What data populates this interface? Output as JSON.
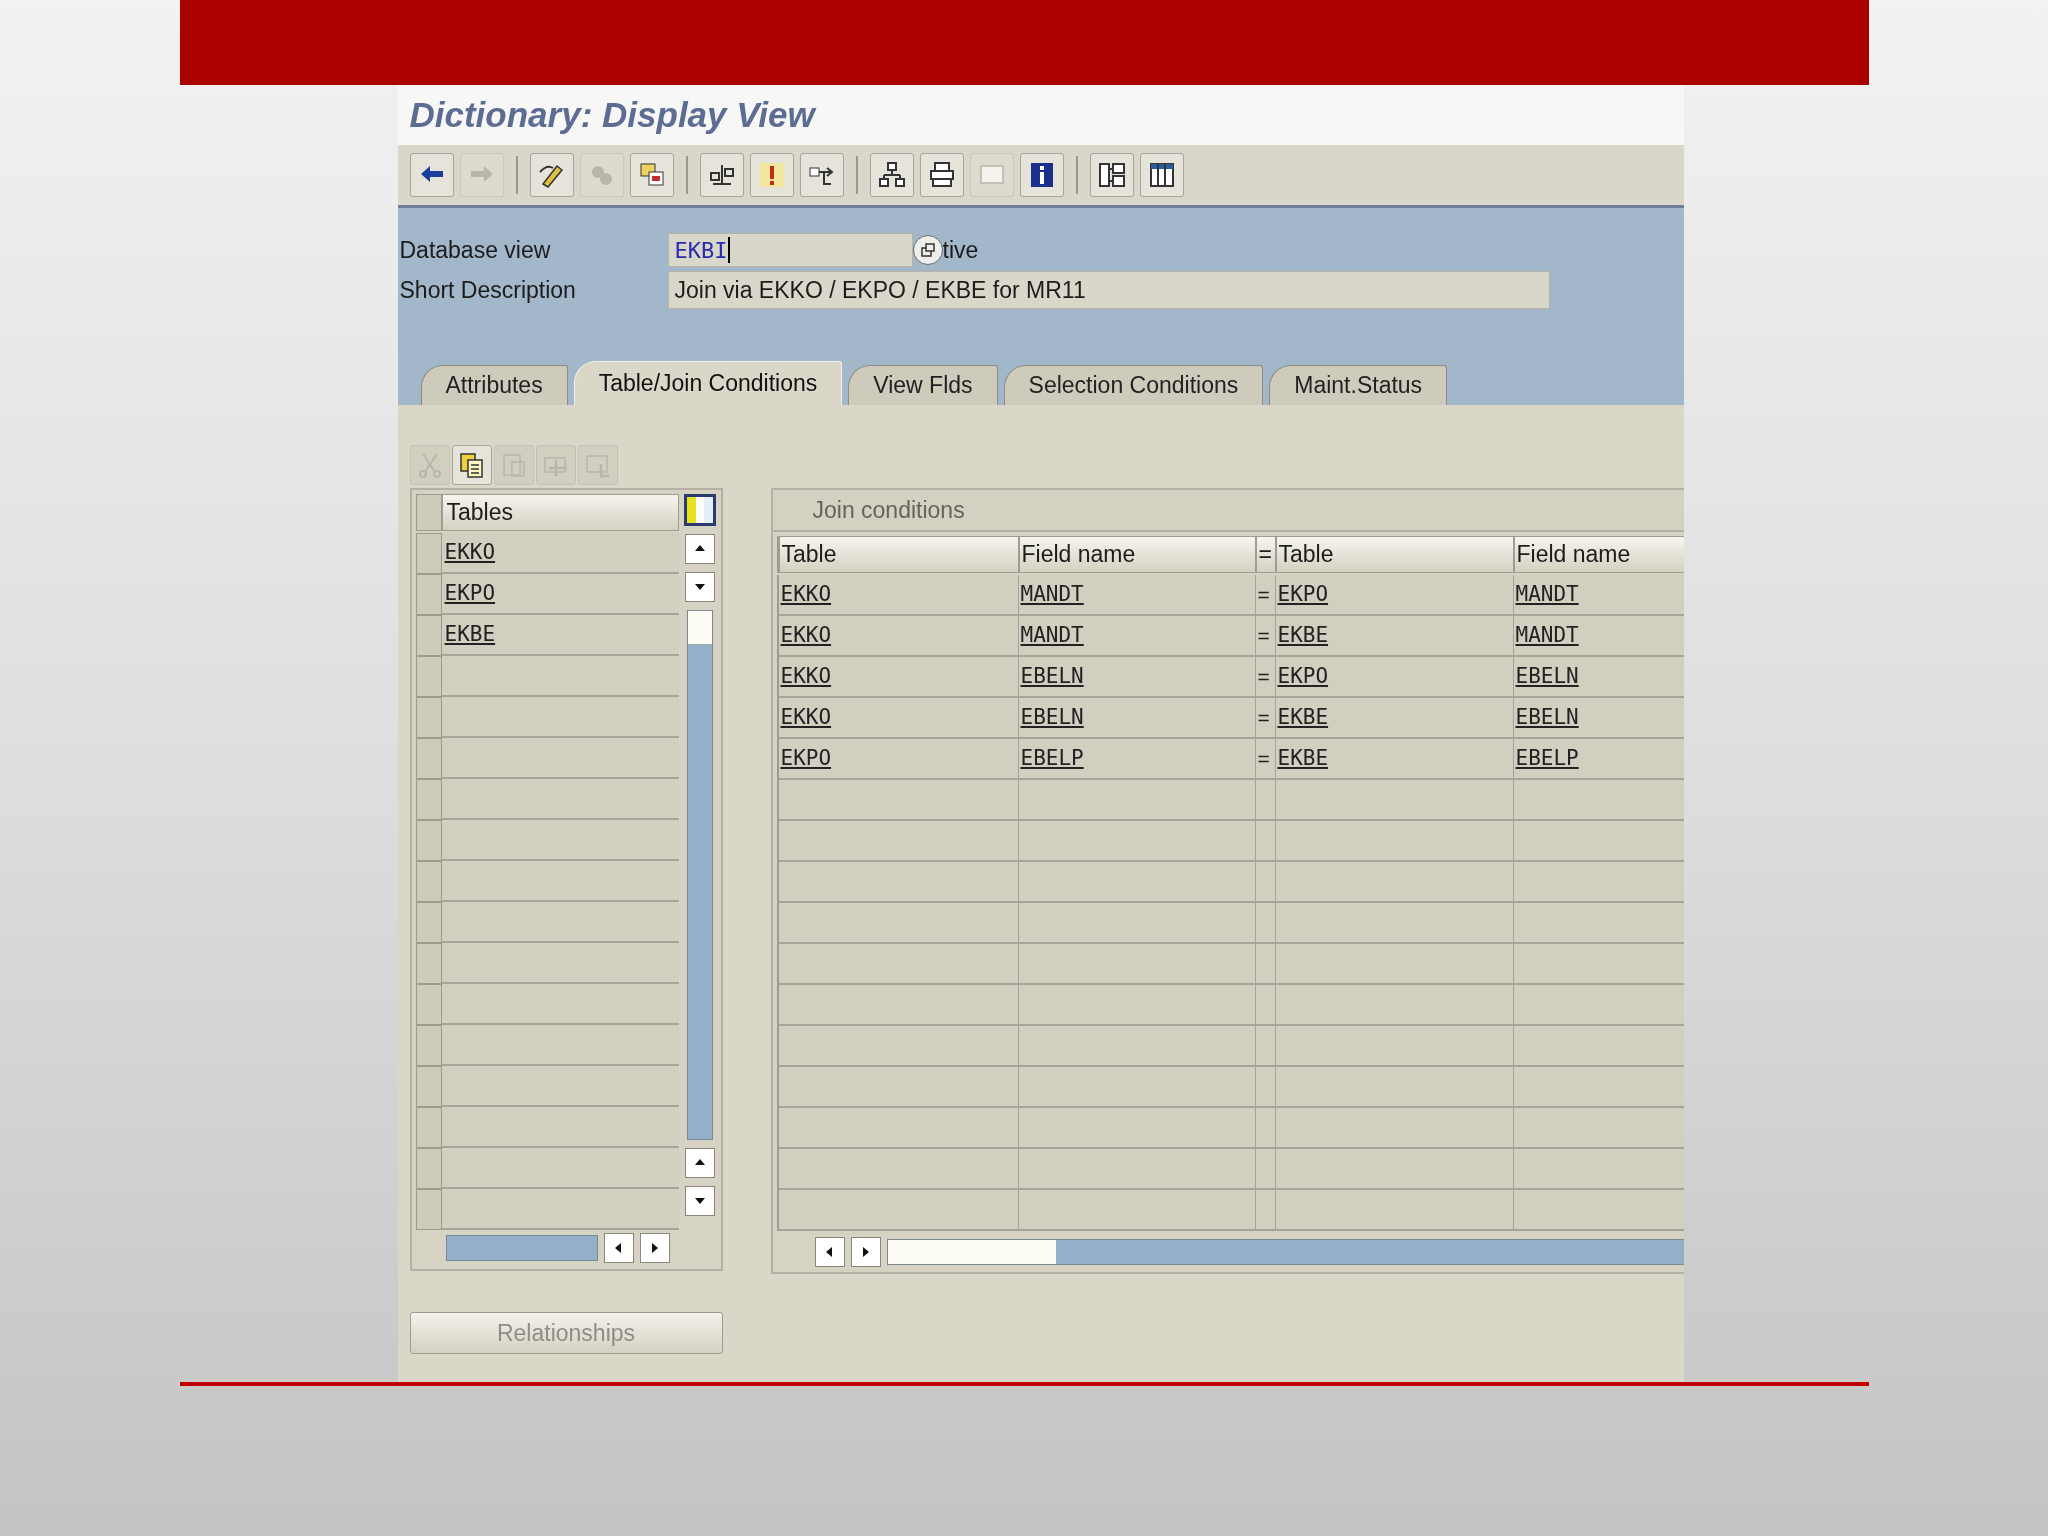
{
  "window": {
    "title": "Dictionary: Display View"
  },
  "toolbar_groups": [
    {
      "buttons": [
        {
          "kind": "back",
          "disabled": false
        },
        {
          "kind": "forward",
          "disabled": true
        }
      ]
    },
    {
      "buttons": [
        {
          "kind": "edit",
          "disabled": false
        },
        {
          "kind": "toggle",
          "disabled": true
        },
        {
          "kind": "objects",
          "disabled": false
        }
      ]
    },
    {
      "buttons": [
        {
          "kind": "check",
          "disabled": false
        },
        {
          "kind": "activate",
          "disabled": false
        },
        {
          "kind": "move",
          "disabled": false
        }
      ]
    },
    {
      "buttons": [
        {
          "kind": "hierarchy",
          "disabled": false
        },
        {
          "kind": "print",
          "disabled": false
        },
        {
          "kind": "screen",
          "disabled": true
        },
        {
          "kind": "info",
          "disabled": false
        }
      ]
    },
    {
      "buttons": [
        {
          "kind": "tree",
          "disabled": false
        },
        {
          "kind": "grid",
          "disabled": false
        }
      ]
    }
  ],
  "fields": [
    {
      "kind": "lookup",
      "label": "Database view",
      "value": "EKBI",
      "focused": true,
      "suffix": "tive"
    },
    {
      "kind": "text",
      "label": "Short Description",
      "value": "Join via EKKO / EKPO / EKBE for MR11",
      "focused": false
    }
  ],
  "tabs": [
    {
      "label": "Attributes",
      "selected": false
    },
    {
      "label": "Table/Join Conditions",
      "selected": true
    },
    {
      "label": "View Flds",
      "selected": false
    },
    {
      "label": "Selection Conditions",
      "selected": false
    },
    {
      "label": "Maint.Status",
      "selected": false
    }
  ],
  "tables_panel": {
    "toolbar": [
      {
        "kind": "cut",
        "disabled": true
      },
      {
        "kind": "copy",
        "disabled": false
      },
      {
        "kind": "paste",
        "disabled": true
      },
      {
        "kind": "insert",
        "disabled": true
      },
      {
        "kind": "delete",
        "disabled": true
      }
    ],
    "header": "Tables",
    "rows": [
      "EKKO",
      "EKPO",
      "EKBE"
    ]
  },
  "join_conditions": {
    "title": "Join conditions",
    "columns": [
      "Table",
      "Field name",
      "=",
      "Table",
      "Field name"
    ],
    "rows": [
      [
        "EKKO",
        "MANDT",
        "=",
        "EKPO",
        "MANDT"
      ],
      [
        "EKKO",
        "MANDT",
        "=",
        "EKBE",
        "MANDT"
      ],
      [
        "EKKO",
        "EBELN",
        "=",
        "EKPO",
        "EBELN"
      ],
      [
        "EKKO",
        "EBELN",
        "=",
        "EKBE",
        "EBELN"
      ],
      [
        "EKPO",
        "EBELP",
        "=",
        "EKBE",
        "EBELP"
      ]
    ]
  },
  "relationships_button": {
    "label": "Relationships",
    "disabled": true
  }
}
